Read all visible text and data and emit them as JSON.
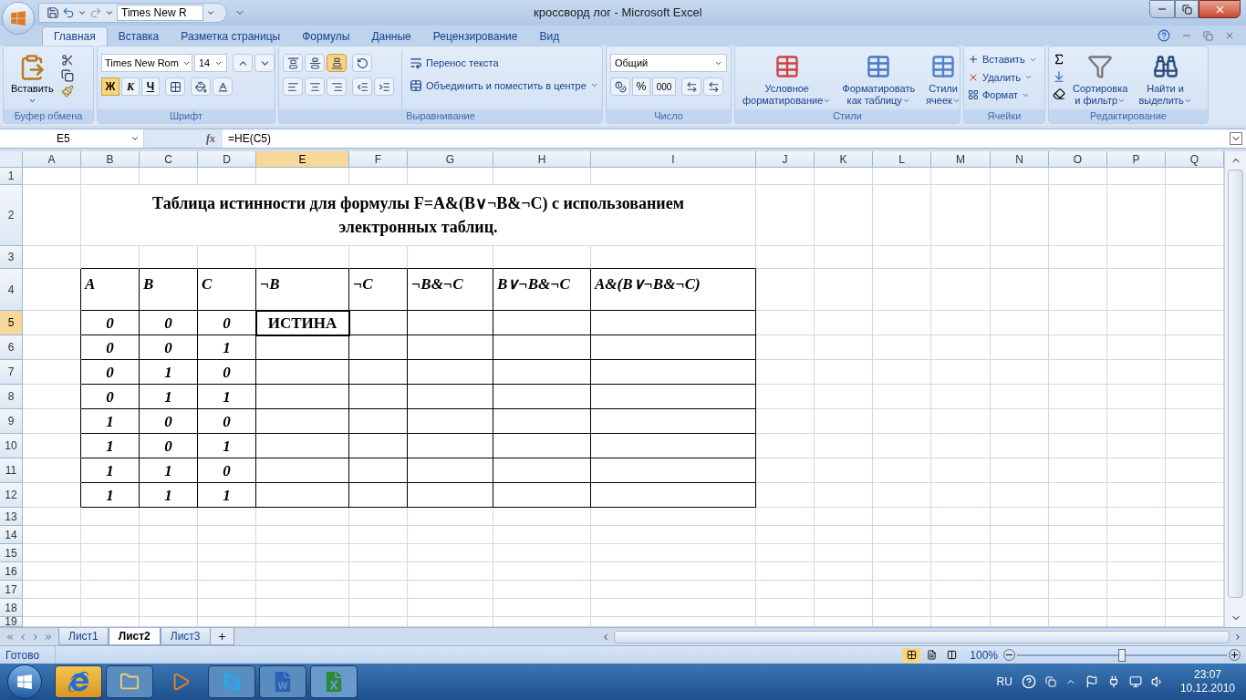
{
  "window": {
    "title": "кроссворд лог - Microsoft Excel"
  },
  "quick_access": {
    "font_field": "Times New R"
  },
  "tabs": [
    {
      "label": "Главная",
      "selected": true
    },
    {
      "label": "Вставка",
      "selected": false
    },
    {
      "label": "Разметка страницы",
      "selected": false
    },
    {
      "label": "Формулы",
      "selected": false
    },
    {
      "label": "Данные",
      "selected": false
    },
    {
      "label": "Рецензирование",
      "selected": false
    },
    {
      "label": "Вид",
      "selected": false
    }
  ],
  "ribbon": {
    "clipboard": {
      "label": "Буфер обмена",
      "paste": "Вставить"
    },
    "font": {
      "label": "Шрифт",
      "font_name": "Times New Rom",
      "font_size": "14",
      "styles": [
        {
          "text": "Ж",
          "kind": "bold",
          "selected": true
        },
        {
          "text": "К",
          "kind": "italic",
          "selected": false
        },
        {
          "text": "Ч",
          "kind": "underline",
          "selected": false
        }
      ]
    },
    "alignment": {
      "label": "Выравнивание",
      "wrap": "Перенос текста",
      "merge": "Объединить и поместить в центре",
      "vertical": [
        {
          "selected": false
        },
        {
          "selected": false
        },
        {
          "selected": true
        }
      ]
    },
    "number": {
      "label": "Число",
      "format": "Общий",
      "percent": "%",
      "thousands": "000"
    },
    "styles": {
      "label": "Стили",
      "buttons": [
        [
          "Условное",
          "форматирование"
        ],
        [
          "Форматировать",
          "как таблицу"
        ],
        [
          "Стили",
          "ячеек"
        ]
      ]
    },
    "cells": {
      "label": "Ячейки",
      "buttons": [
        "Вставить",
        "Удалить",
        "Формат"
      ]
    },
    "editing": {
      "label": "Редактирование",
      "buttons": [
        [
          "Сортировка",
          "и фильтр"
        ],
        [
          "Найти и",
          "выделить"
        ]
      ]
    }
  },
  "formula_bar": {
    "name_box": "E5",
    "fx": "fx",
    "formula": "=НЕ(C5)"
  },
  "sheet": {
    "columns": [
      {
        "label": "A",
        "selected": false
      },
      {
        "label": "B",
        "selected": false
      },
      {
        "label": "C",
        "selected": false
      },
      {
        "label": "D",
        "selected": false
      },
      {
        "label": "E",
        "selected": true
      },
      {
        "label": "F",
        "selected": false
      },
      {
        "label": "G",
        "selected": false
      },
      {
        "label": "H",
        "selected": false
      },
      {
        "label": "I",
        "selected": false
      },
      {
        "label": "J",
        "selected": false
      },
      {
        "label": "K",
        "selected": false
      },
      {
        "label": "L",
        "selected": false
      },
      {
        "label": "M",
        "selected": false
      },
      {
        "label": "N",
        "selected": false
      },
      {
        "label": "O",
        "selected": false
      },
      {
        "label": "P",
        "selected": false
      },
      {
        "label": "Q",
        "selected": false
      }
    ],
    "rows": [
      {
        "label": "1",
        "selected": false
      },
      {
        "label": "2",
        "selected": false
      },
      {
        "label": "3",
        "selected": false
      },
      {
        "label": "4",
        "selected": false
      },
      {
        "label": "5",
        "selected": true
      },
      {
        "label": "6",
        "selected": false
      },
      {
        "label": "7",
        "selected": false
      },
      {
        "label": "8",
        "selected": false
      },
      {
        "label": "9",
        "selected": false
      },
      {
        "label": "10",
        "selected": false
      },
      {
        "label": "11",
        "selected": false
      },
      {
        "label": "12",
        "selected": false
      },
      {
        "label": "13",
        "selected": false
      },
      {
        "label": "14",
        "selected": false
      },
      {
        "label": "15",
        "selected": false
      },
      {
        "label": "16",
        "selected": false
      },
      {
        "label": "17",
        "selected": false
      },
      {
        "label": "18",
        "selected": false
      },
      {
        "label": "19",
        "selected": false
      }
    ],
    "title": "Таблица истинности для формулы F=A&(B∨¬B&¬C) с использованием электронных таблиц.",
    "table": {
      "header": [
        "A",
        "B",
        "C",
        "¬B",
        "¬C",
        "¬B&¬C",
        "B∨¬B&¬C",
        "A&(B∨¬B&¬C)"
      ],
      "rows": [
        [
          "0",
          "0",
          "0",
          "ИСТИНА"
        ],
        [
          "0",
          "0",
          "1"
        ],
        [
          "0",
          "1",
          "0"
        ],
        [
          "0",
          "1",
          "1"
        ],
        [
          "1",
          "0",
          "0"
        ],
        [
          "1",
          "0",
          "1"
        ],
        [
          "1",
          "1",
          "0"
        ],
        [
          "1",
          "1",
          "1"
        ]
      ]
    }
  },
  "sheet_tabs": [
    {
      "label": "Лист1",
      "selected": false
    },
    {
      "label": "Лист2",
      "selected": true
    },
    {
      "label": "Лист3",
      "selected": false
    }
  ],
  "status_bar": {
    "status": "Готово",
    "zoom": "100%",
    "zoom_slider": {
      "level": 0.5
    }
  },
  "taskbar": {
    "language": "RU",
    "time": "23:07",
    "date": "10.12.2010"
  }
}
